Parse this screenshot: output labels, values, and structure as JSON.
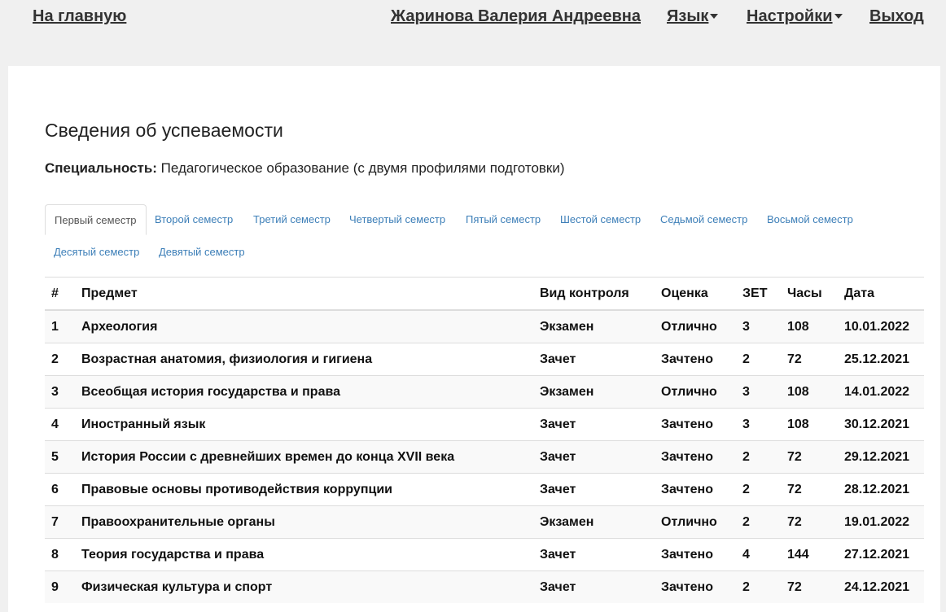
{
  "nav": {
    "home": "На главную",
    "user": "Жаринова Валерия Андреевна",
    "language": "Язык",
    "settings": "Настройки",
    "logout": "Выход"
  },
  "page": {
    "title": "Сведения об успеваемости",
    "specialty_label": "Специальность:",
    "specialty_value": "Педагогическое образование (с двумя профилями подготовки)"
  },
  "tabs": [
    "Первый семестр",
    "Второй семестр",
    "Третий семестр",
    "Четвертый семестр",
    "Пятый семестр",
    "Шестой семестр",
    "Седьмой семестр",
    "Восьмой семестр",
    "Десятый семестр",
    "Девятый семестр"
  ],
  "active_tab": 0,
  "table": {
    "headers": [
      "#",
      "Предмет",
      "Вид контроля",
      "Оценка",
      "ЗЕТ",
      "Часы",
      "Дата"
    ],
    "rows": [
      [
        "1",
        "Археология",
        "Экзамен",
        "Отлично",
        "3",
        "108",
        "10.01.2022"
      ],
      [
        "2",
        "Возрастная анатомия, физиология и гигиена",
        "Зачет",
        "Зачтено",
        "2",
        "72",
        "25.12.2021"
      ],
      [
        "3",
        "Всеобщая история государства и права",
        "Экзамен",
        "Отлично",
        "3",
        "108",
        "14.01.2022"
      ],
      [
        "4",
        "Иностранный язык",
        "Зачет",
        "Зачтено",
        "3",
        "108",
        "30.12.2021"
      ],
      [
        "5",
        "История России с древнейших времен до конца XVII века",
        "Зачет",
        "Зачтено",
        "2",
        "72",
        "29.12.2021"
      ],
      [
        "6",
        "Правовые основы противодействия коррупции",
        "Зачет",
        "Зачтено",
        "2",
        "72",
        "28.12.2021"
      ],
      [
        "7",
        "Правоохранительные органы",
        "Экзамен",
        "Отлично",
        "2",
        "72",
        "19.01.2022"
      ],
      [
        "8",
        "Теория государства и права",
        "Зачет",
        "Зачтено",
        "4",
        "144",
        "27.12.2021"
      ],
      [
        "9",
        "Физическая культура и спорт",
        "Зачет",
        "Зачтено",
        "2",
        "72",
        "24.12.2021"
      ]
    ]
  }
}
